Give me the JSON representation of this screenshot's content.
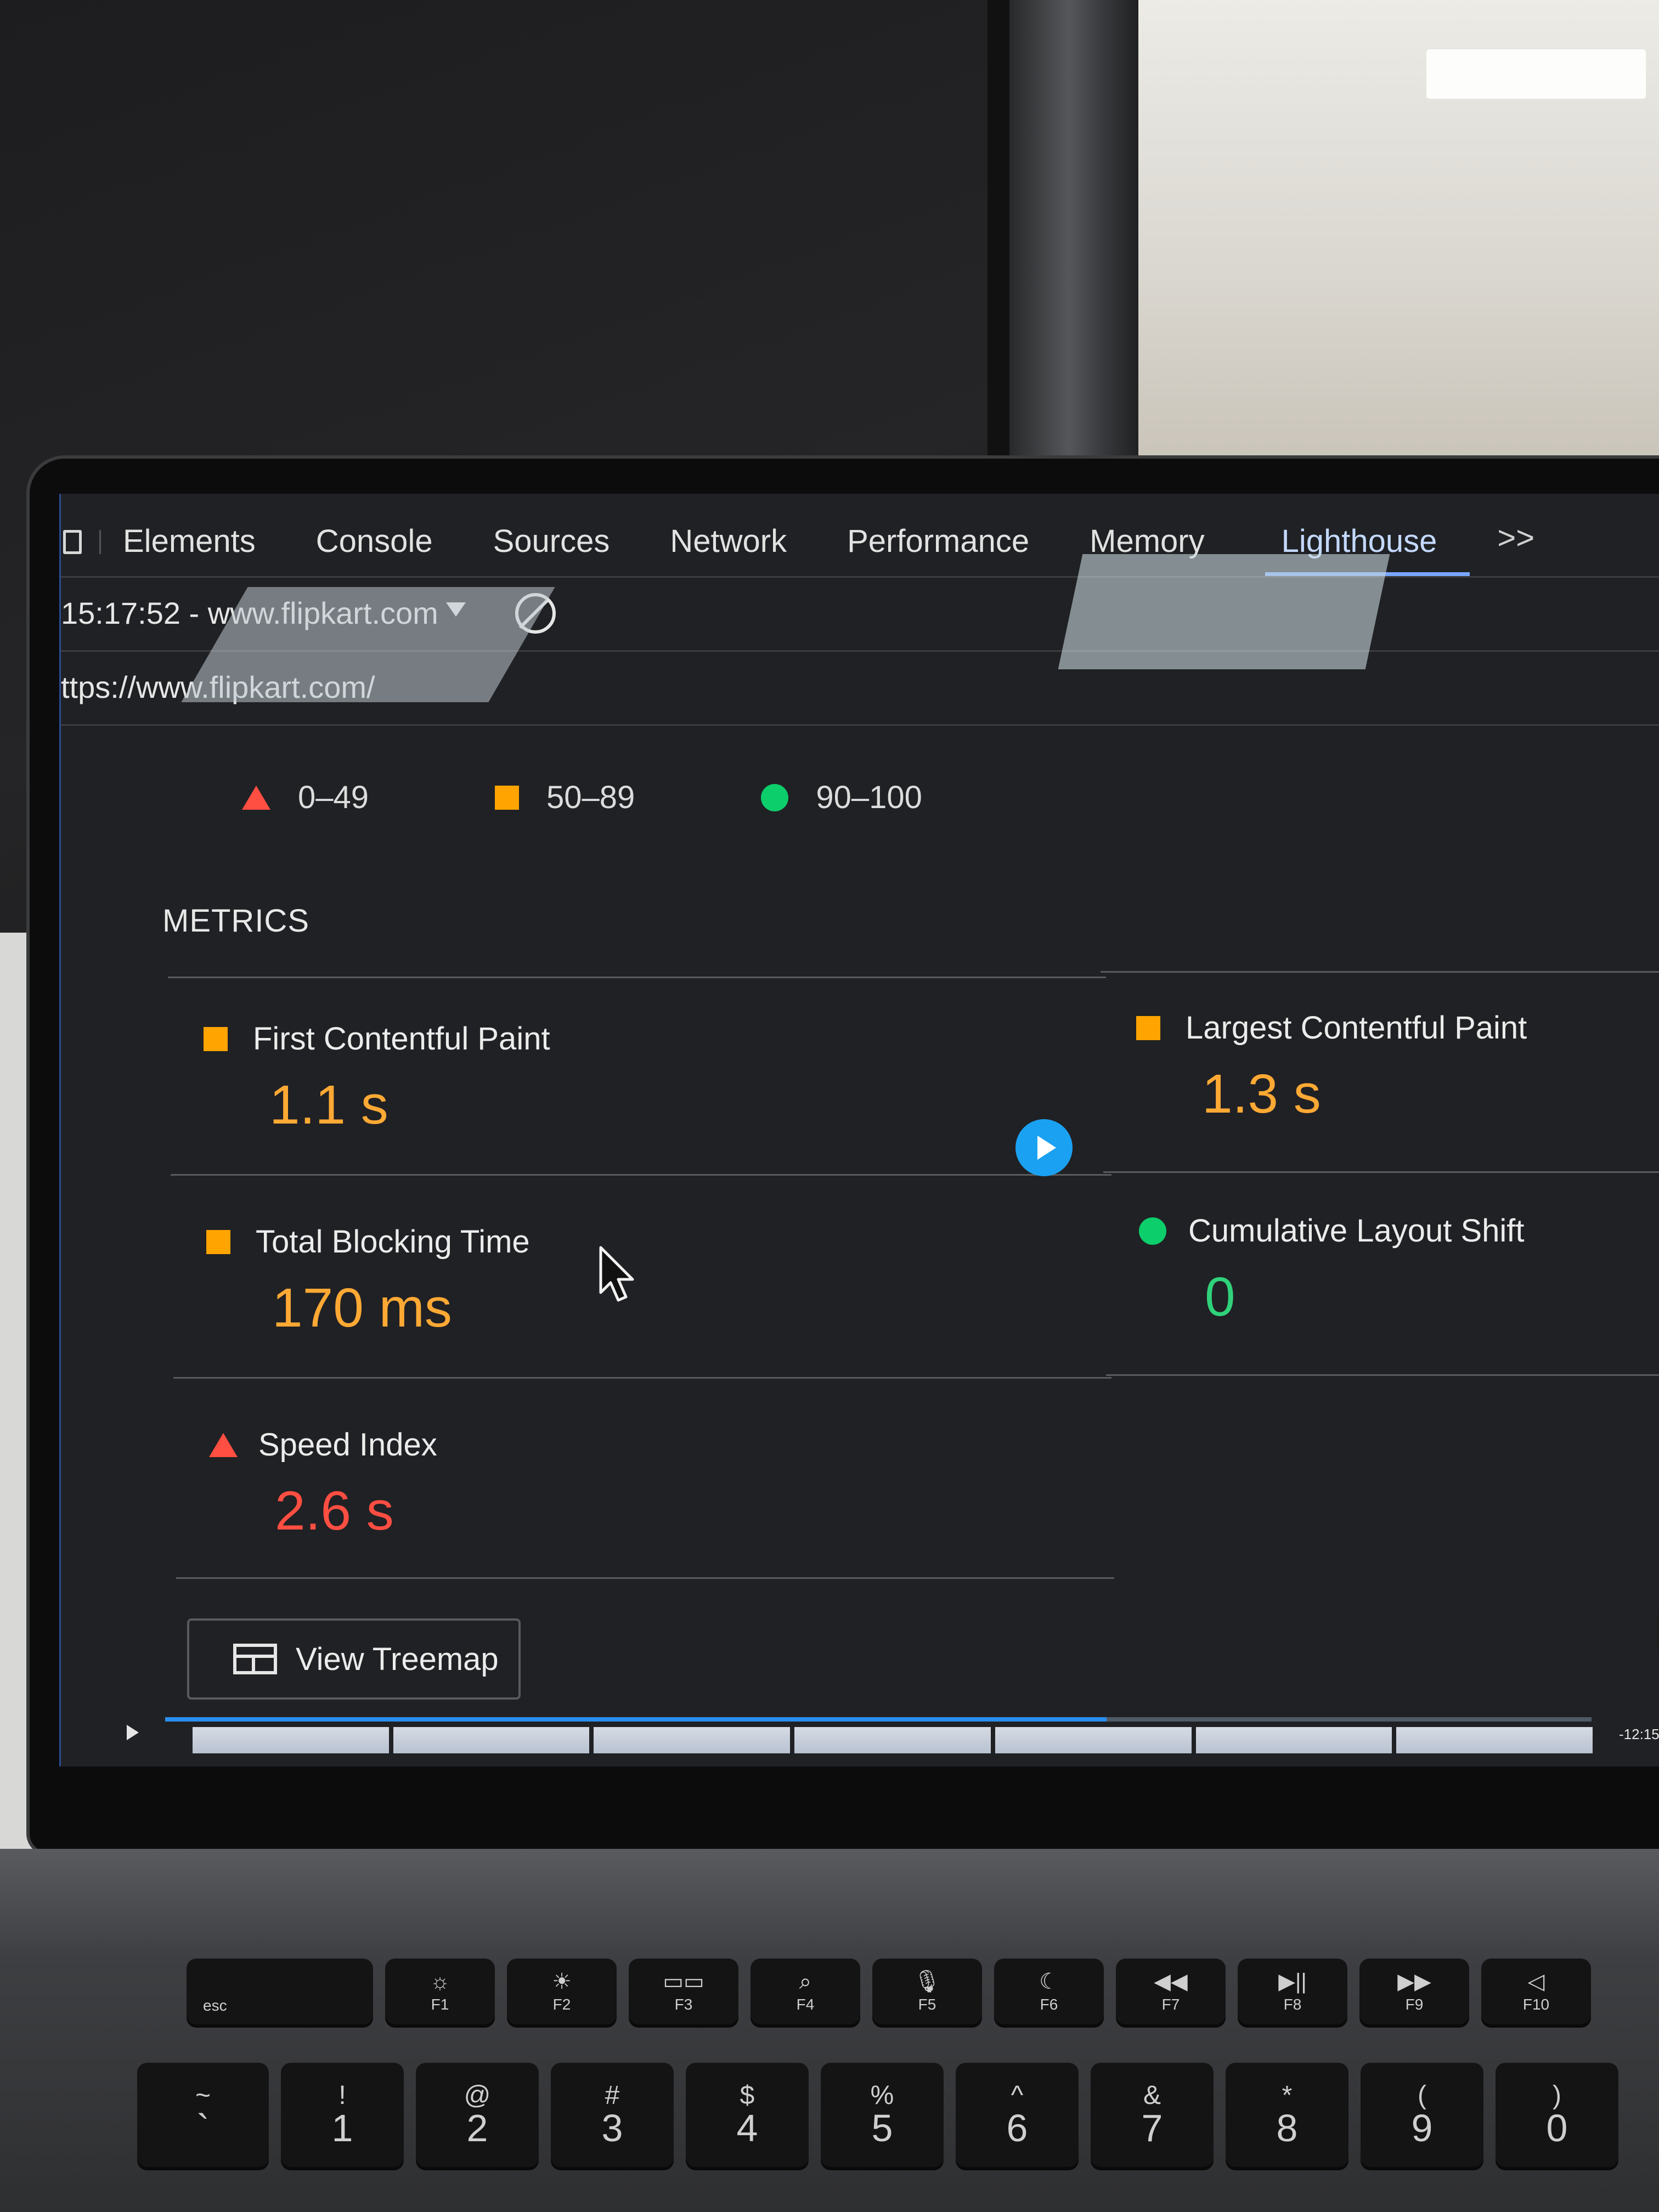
{
  "devtools": {
    "tabs": [
      {
        "label": "Elements",
        "active": false
      },
      {
        "label": "Console",
        "active": false
      },
      {
        "label": "Sources",
        "active": false
      },
      {
        "label": "Network",
        "active": false
      },
      {
        "label": "Performance",
        "active": false
      },
      {
        "label": "Memory",
        "active": false
      },
      {
        "label": "Lighthouse",
        "active": true
      }
    ],
    "more_tabs_label": ">>",
    "session_label": "15:17:52 - www.flipkart.com",
    "url": "ttps://www.flipkart.com/"
  },
  "legend": [
    {
      "shape": "triangle",
      "color": "#ff4e42",
      "label": "0–49"
    },
    {
      "shape": "square",
      "color": "#ffa400",
      "label": "50–89"
    },
    {
      "shape": "circle",
      "color": "#0cce6b",
      "label": "90–100"
    }
  ],
  "metrics_section": {
    "title": "METRICS",
    "metrics": [
      {
        "name": "First Contentful Paint",
        "value": "1.1 s",
        "rating": "average"
      },
      {
        "name": "Largest Contentful Paint",
        "value": "1.3 s",
        "rating": "average"
      },
      {
        "name": "Total Blocking Time",
        "value": "170 ms",
        "rating": "average"
      },
      {
        "name": "Cumulative Layout Shift",
        "value": "0",
        "rating": "pass"
      },
      {
        "name": "Speed Index",
        "value": "2.6 s",
        "rating": "fail"
      }
    ]
  },
  "treemap_button": {
    "label": "View Treemap"
  },
  "video_player": {
    "time_label": "-12:15",
    "progress": 0.66
  },
  "keyboard": {
    "function_row": [
      {
        "symbol": "",
        "label": "esc"
      },
      {
        "symbol": "☼",
        "label": "F1"
      },
      {
        "symbol": "☀",
        "label": "F2"
      },
      {
        "symbol": "▭▭",
        "label": "F3"
      },
      {
        "symbol": "⌕",
        "label": "F4"
      },
      {
        "symbol": "🎙",
        "label": "F5"
      },
      {
        "symbol": "☾",
        "label": "F6"
      },
      {
        "symbol": "◀◀",
        "label": "F7"
      },
      {
        "symbol": "▶||",
        "label": "F8"
      },
      {
        "symbol": "▶▶",
        "label": "F9"
      },
      {
        "symbol": "◁",
        "label": "F10"
      }
    ],
    "number_row": [
      {
        "top": "~",
        "bottom": "`"
      },
      {
        "top": "!",
        "bottom": "1"
      },
      {
        "top": "@",
        "bottom": "2"
      },
      {
        "top": "#",
        "bottom": "3"
      },
      {
        "top": "$",
        "bottom": "4"
      },
      {
        "top": "%",
        "bottom": "5"
      },
      {
        "top": "^",
        "bottom": "6"
      },
      {
        "top": "&",
        "bottom": "7"
      },
      {
        "top": "*",
        "bottom": "8"
      },
      {
        "top": "(",
        "bottom": "9"
      },
      {
        "top": ")",
        "bottom": "0"
      }
    ]
  }
}
